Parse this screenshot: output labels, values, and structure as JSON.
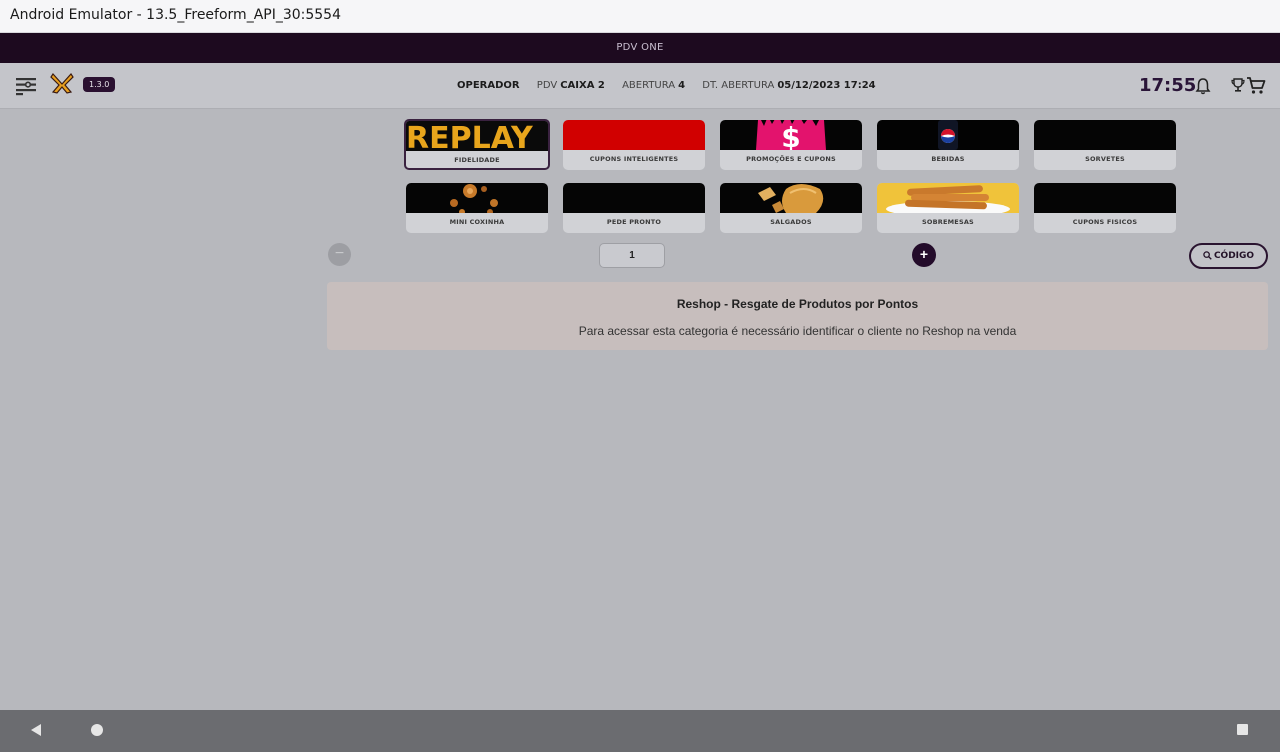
{
  "window": {
    "title": "Android Emulator - 13.5_Freeform_API_30:5554"
  },
  "app_bar": {
    "title": "PDV ONE"
  },
  "header": {
    "version": "1.3.0",
    "operador_label": "OPERADOR",
    "pdv_label": "PDV",
    "pdv_value": "CAIXA 2",
    "abertura_label": "ABERTURA",
    "abertura_value": "4",
    "dt_abertura_label": "DT. ABERTURA",
    "dt_abertura_value": "05/12/2023 17:24",
    "clock": "17:55"
  },
  "categories": [
    {
      "label": "FIDELIDADE",
      "image_text": "REPLAY",
      "active": true
    },
    {
      "label": "CUPONS INTELIGENTES",
      "active": false
    },
    {
      "label": "PROMOÇÕES E CUPONS",
      "image_text": "$",
      "active": false
    },
    {
      "label": "BEBIDAS",
      "active": false
    },
    {
      "label": "SORVETES",
      "active": false
    },
    {
      "label": "MINI COXINHA",
      "active": false
    },
    {
      "label": "PEDE PRONTO",
      "active": false
    },
    {
      "label": "SALGADOS",
      "active": false
    },
    {
      "label": "SOBREMESAS",
      "active": false
    },
    {
      "label": "CUPONS FISICOS",
      "active": false
    }
  ],
  "quantity": {
    "minus": "−",
    "value": "1",
    "plus": "+"
  },
  "code_button": {
    "label": "CÓDIGO"
  },
  "reshop": {
    "title": "Reshop - Resgate de Produtos por Pontos",
    "message": "Para acessar esta categoria é necessário identificar o cliente no Reshop na venda"
  },
  "colors": {
    "app_bar": "#1d0a1f",
    "accent": "#230b2a",
    "background": "#b7b8bd",
    "reshop_banner": "#c7bebd"
  }
}
